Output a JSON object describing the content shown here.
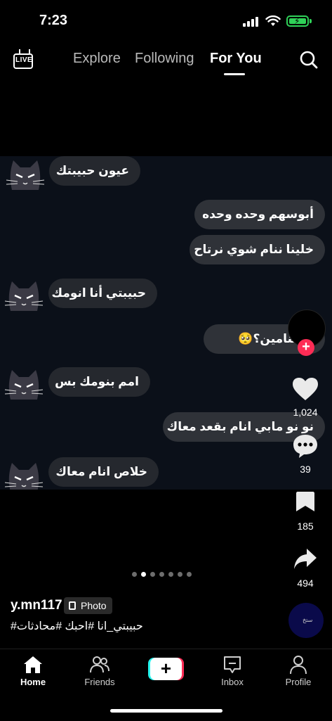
{
  "status_bar": {
    "time": "7:23"
  },
  "top_nav": {
    "live_label": "LIVE",
    "tabs": [
      {
        "label": "Explore",
        "active": false
      },
      {
        "label": "Following",
        "active": false
      },
      {
        "label": "For You",
        "active": true
      }
    ]
  },
  "chat": {
    "messages": [
      {
        "side": "left",
        "text": "عيون حبيبتك"
      },
      {
        "side": "right",
        "text": "أبوسهم وحده وحده"
      },
      {
        "side": "right",
        "text": "خلينا ننام شوي نرتاح"
      },
      {
        "side": "left",
        "text": "حبيبتي أنا انومك"
      },
      {
        "side": "right",
        "text": "م بتنامين؟🥺"
      },
      {
        "side": "left",
        "text": "امم بنومك بس"
      },
      {
        "side": "right",
        "text": "نو نو مابي انام بقعد معاك"
      },
      {
        "side": "left",
        "text": "خلاص انام معاك"
      }
    ]
  },
  "actions": {
    "like_count": "1,024",
    "comment_count": "39",
    "bookmark_count": "185",
    "share_count": "494"
  },
  "carousel": {
    "total": 7,
    "active_index": 1
  },
  "post": {
    "username": "y.mn117",
    "tag_label": "Photo",
    "caption": "#حبيبتي_انا #احبك #محادثات",
    "sound_label": "ستخ"
  },
  "bottom_nav": {
    "items": [
      {
        "label": "Home",
        "active": true
      },
      {
        "label": "Friends"
      },
      {
        "label": ""
      },
      {
        "label": "Inbox"
      },
      {
        "label": "Profile"
      }
    ]
  },
  "colors": {
    "accent_red": "#fe2c55",
    "accent_cyan": "#25f4ee",
    "battery": "#2fd158"
  }
}
